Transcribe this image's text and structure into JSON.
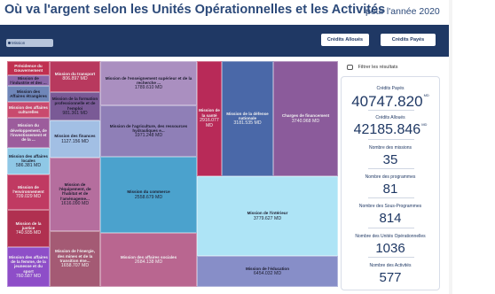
{
  "header": {
    "title": "Où va l'argent selon les Unités Opérationnelles et les Activités",
    "period": "pour l'année 2020"
  },
  "toolbar": {
    "chip_label": "Mission",
    "btn_alloues": "Crédits Alloués",
    "btn_payes": "Crédits Payés"
  },
  "filter": {
    "label": "Filtrer les résultats"
  },
  "kpis": {
    "credits_payes_label": "Crédits Payés",
    "credits_payes_value": "40747.820",
    "credits_payes_unit": "MD",
    "credits_alloues_label": "Crédits Alloués",
    "credits_alloues_value": "42185.846",
    "credits_alloues_unit": "MD",
    "missions_label": "Nombre des missions",
    "missions_value": "35",
    "programmes_label": "Nombre des programmes",
    "programmes_value": "81",
    "sous_programmes_label": "Nombre des Sous-Programmes",
    "sous_programmes_value": "814",
    "uo_label": "Nombre des Unités Opérationnelles",
    "uo_value": "1036",
    "activites_label": "Nombre des Activités",
    "activites_value": "577"
  },
  "treemap": {
    "tiles": [
      {
        "label": "Présidence du Gouvernement",
        "value": "",
        "color": "#c03050"
      },
      {
        "label": "Mission de l'industrie et des ...",
        "value": "",
        "color": "#8a66a8"
      },
      {
        "label": "Mission des Affaires étrangères",
        "value": "",
        "color": "#6f86b8"
      },
      {
        "label": "Mission des affaires culturelles",
        "value": "",
        "color": "#c94a6e"
      },
      {
        "label": "Mission du développement, de l'investissement et de la ...",
        "value": "",
        "color": "#9c5c9c"
      },
      {
        "label": "Mission des affaires locales",
        "value": "586.381 MD",
        "color": "#8fc8e6"
      },
      {
        "label": "Mission de l'environnement",
        "value": "709.029 MD",
        "color": "#c03a62"
      },
      {
        "label": "Mission de la justice",
        "value": "740.935 MD",
        "color": "#b03050"
      },
      {
        "label": "Mission des affaires de la femme, de la jeunesse et du sport",
        "value": "760.587 MD",
        "color": "#8e4ec8"
      },
      {
        "label": "Mission du transport",
        "value": "806.897 MD",
        "color": "#b8395e"
      },
      {
        "label": "Mission de la formation professionnelle et de l'emploi",
        "value": "981.361 MD",
        "color": "#7a5a96"
      },
      {
        "label": "Mission des finances",
        "value": "1127.156 MD",
        "color": "#a2bfe4"
      },
      {
        "label": "Mission de l'équipement, de l'habitat et de l'aménageme...",
        "value": "1616.090 MD",
        "color": "#b56e9e"
      },
      {
        "label": "Mission de l'énergie, des mines et de la transition éne...",
        "value": "1658.707 MD",
        "color": "#a45a74"
      },
      {
        "label": "Mission de l'enseignement supérieur et de la recherche ...",
        "value": "1789.610 MD",
        "color": "#aa8fc0"
      },
      {
        "label": "Mission de l'agriculture, des ressources hydrauliques e...",
        "value": "1971.248 MD",
        "color": "#8f7fb7"
      },
      {
        "label": "Mission du commerce",
        "value": "2558.679 MD",
        "color": "#4ba2cd"
      },
      {
        "label": "Mission des affaires sociales",
        "value": "2684.138 MD",
        "color": "#b96690"
      },
      {
        "label": "Mission de la santé",
        "value": "2916.077 MD",
        "color": "#b82a58"
      },
      {
        "label": "Mission de la défense nationale",
        "value": "3181.535 MD",
        "color": "#4a68a8"
      },
      {
        "label": "Charges de financement",
        "value": "3740.968 MD",
        "color": "#8b5b9b"
      },
      {
        "label": "Mission de l'intérieur",
        "value": "3779.627 MD",
        "color": "#aee4f6"
      },
      {
        "label": "Mission de l'éducation",
        "value": "6454.032 MD",
        "color": "#878ec8"
      }
    ]
  }
}
